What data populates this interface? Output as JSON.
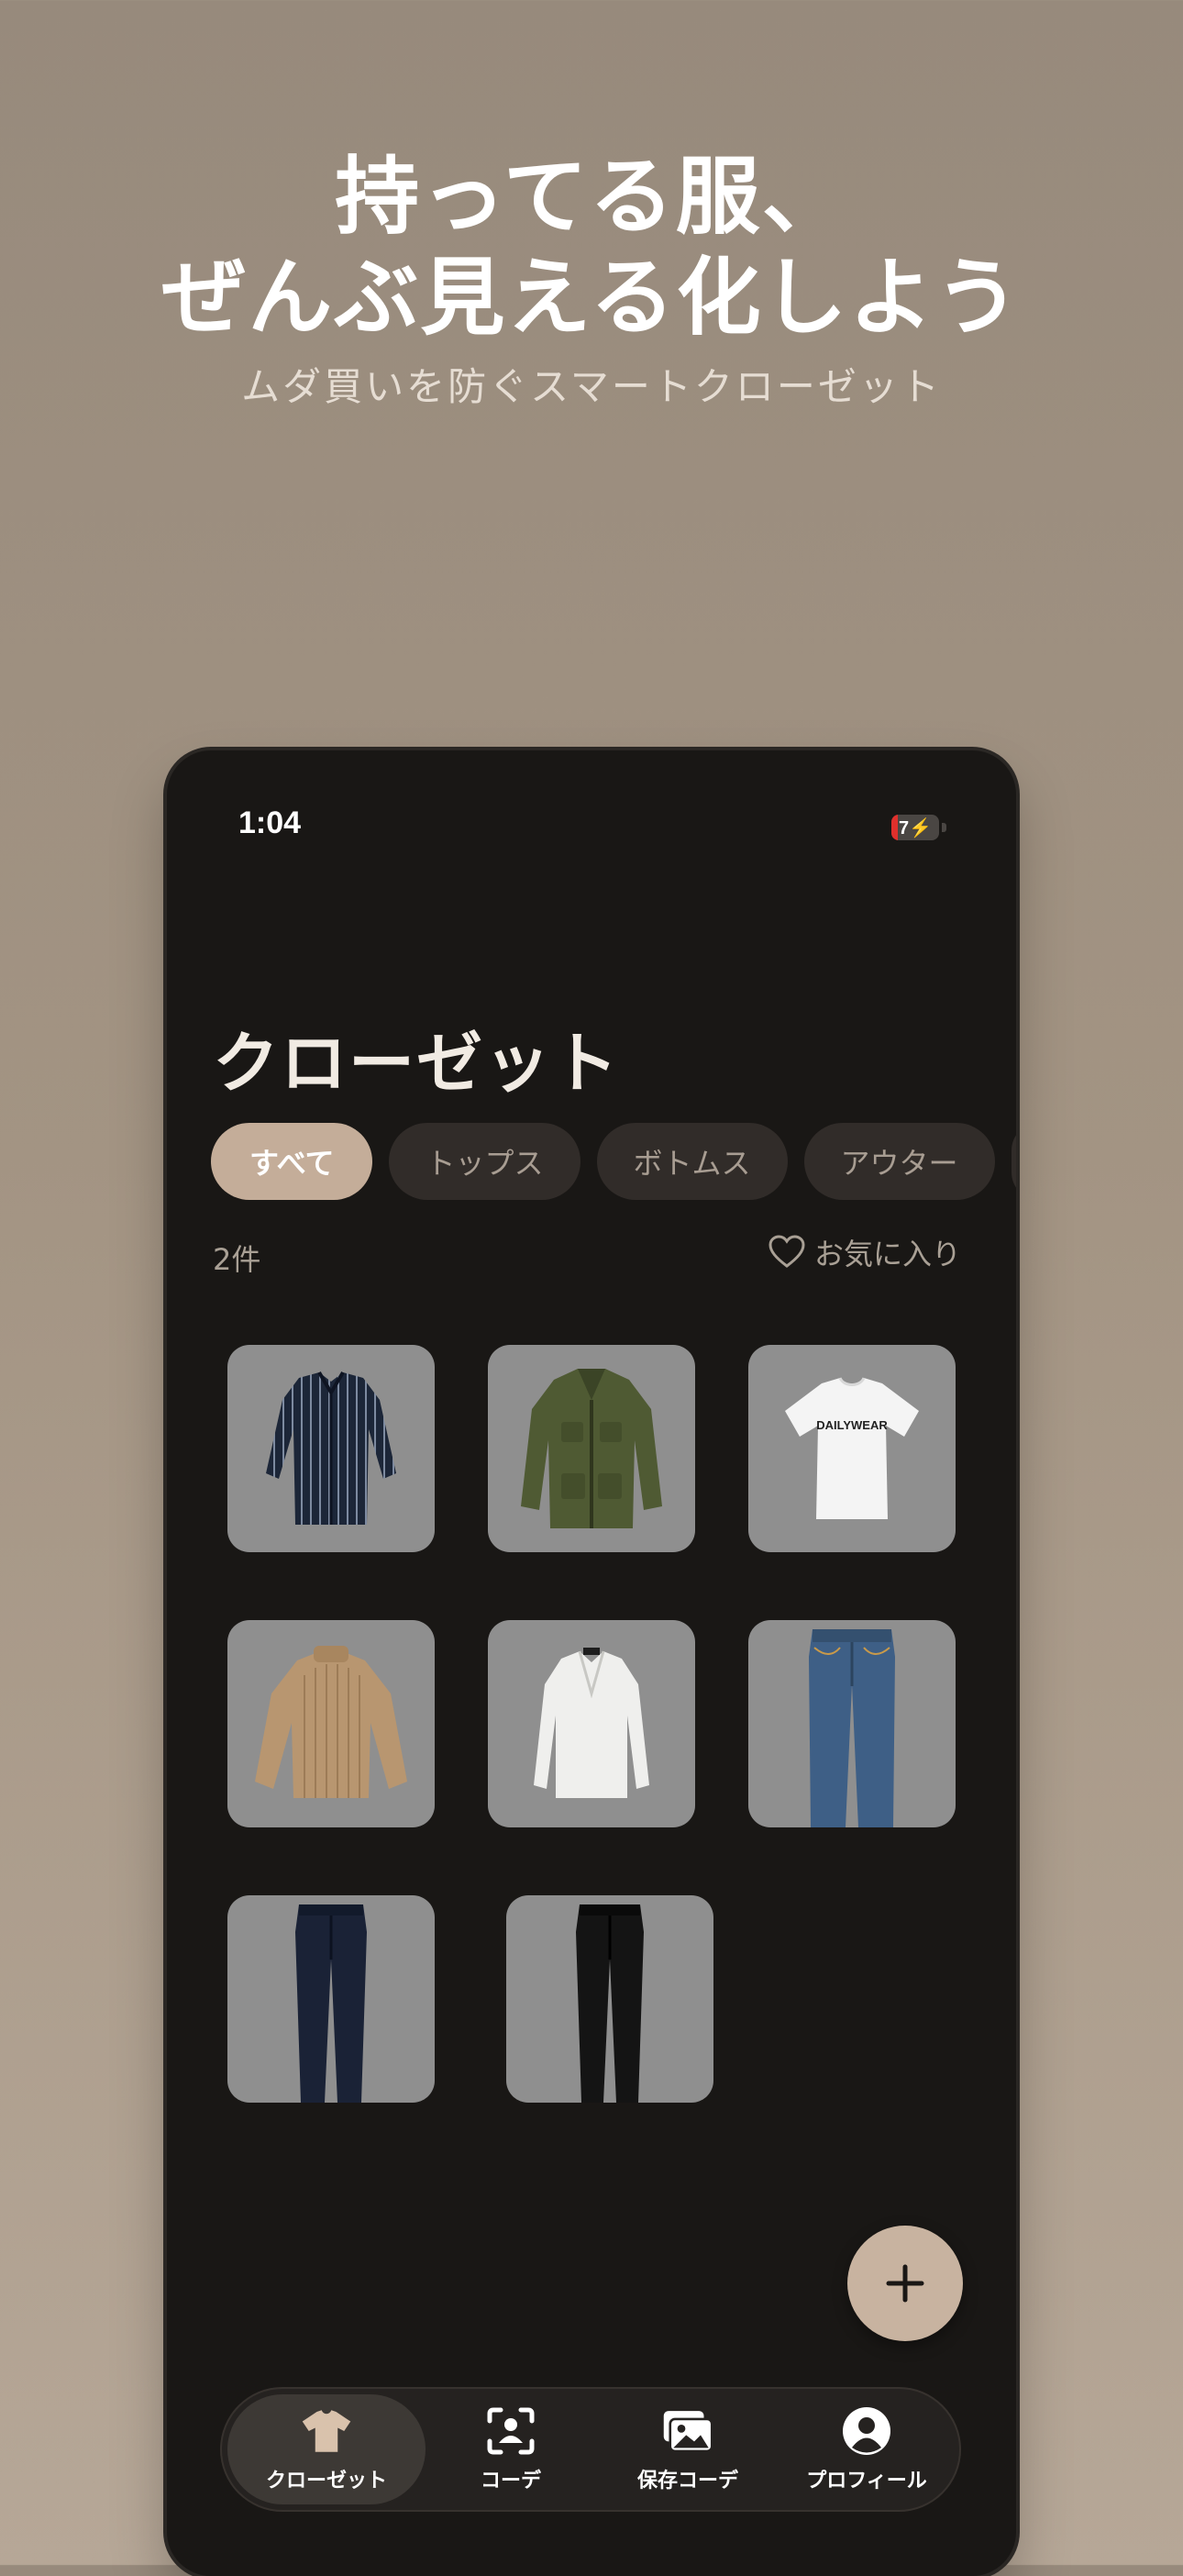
{
  "hero": {
    "title_line1": "持ってる服、",
    "title_line2": "ぜんぶ見える化しよう",
    "subtitle": "ムダ買いを防ぐスマートクローゼット"
  },
  "status_bar": {
    "time": "1:04",
    "battery": "7"
  },
  "page": {
    "title": "クローゼット"
  },
  "filters": [
    {
      "label": "すべて",
      "selected": true
    },
    {
      "label": "トップス",
      "selected": false
    },
    {
      "label": "ボトムス",
      "selected": false
    },
    {
      "label": "アウター",
      "selected": false
    }
  ],
  "summary": {
    "count": "2件",
    "favorites_label": "お気に入り"
  },
  "items": [
    {
      "icon": "striped-shirt-image"
    },
    {
      "icon": "olive-jacket-image"
    },
    {
      "icon": "white-tshirt-image",
      "print": "DAILYWEAR"
    },
    {
      "icon": "beige-sweater-image"
    },
    {
      "icon": "white-blouse-image"
    },
    {
      "icon": "blue-jeans-image"
    },
    {
      "icon": "navy-trousers-image"
    },
    {
      "icon": "black-trousers-image"
    }
  ],
  "fab": {
    "icon": "plus-icon"
  },
  "tabbar": {
    "tabs": [
      {
        "label": "クローゼット",
        "icon": "tshirt-icon",
        "active": true
      },
      {
        "label": "コーデ",
        "icon": "person-scan-icon",
        "active": false
      },
      {
        "label": "保存コーデ",
        "icon": "photos-icon",
        "active": false
      },
      {
        "label": "プロフィール",
        "icon": "profile-icon",
        "active": false
      }
    ]
  },
  "colors": {
    "background_top": "#978a7c",
    "phone_bg": "#191715",
    "accent": "#c8b3a0",
    "chip_bg": "#312c29",
    "tile_bg": "#8f8f8f"
  }
}
